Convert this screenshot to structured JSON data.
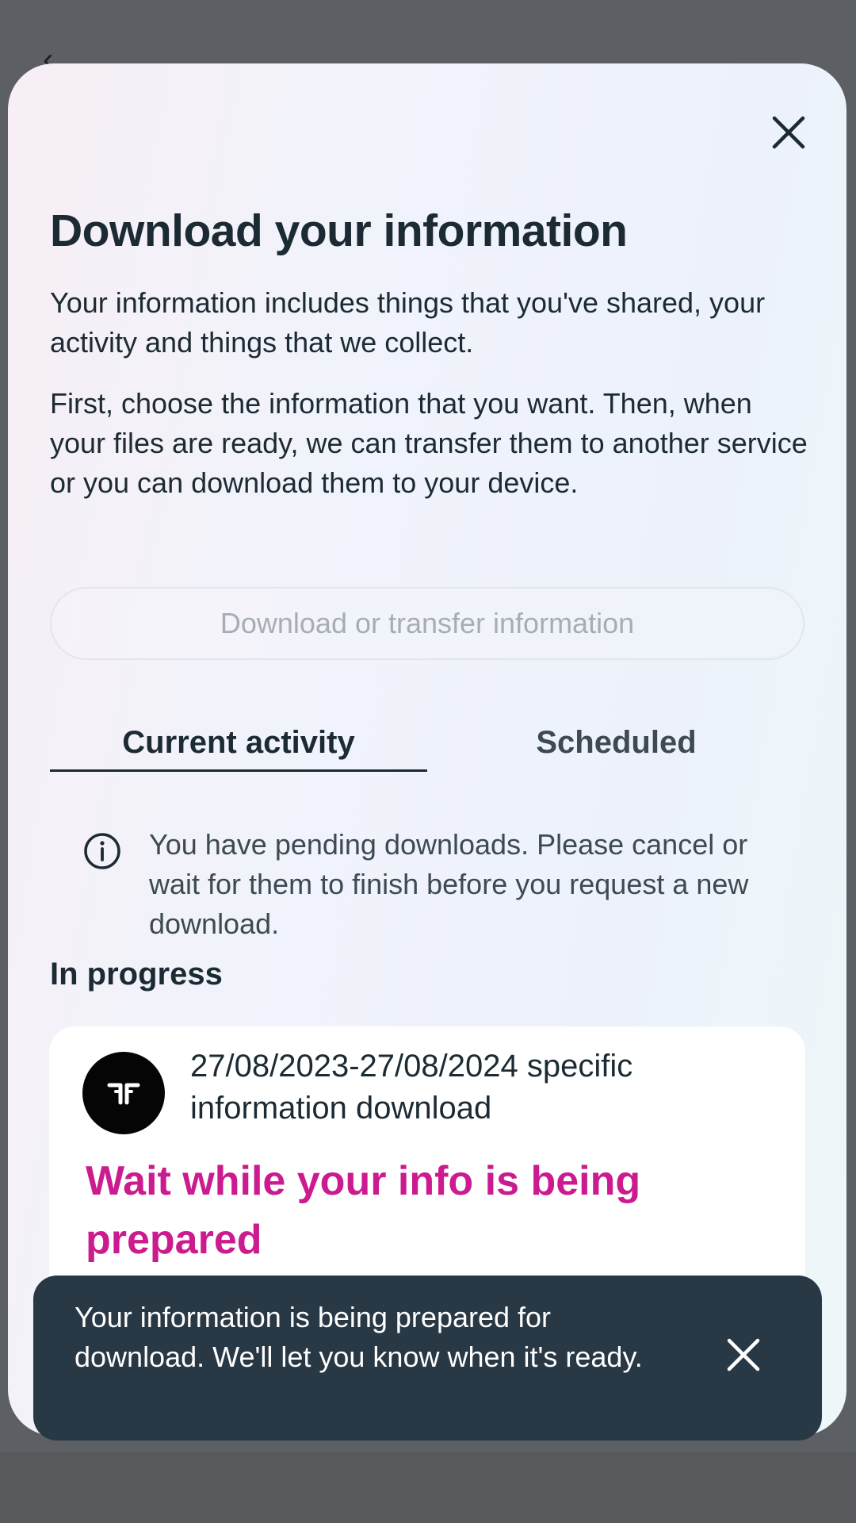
{
  "modal": {
    "title": "Download your information",
    "description_1": "Your information includes things that you've shared, your activity and things that we collect.",
    "description_2": "First, choose the information that you want. Then, when your files are ready, we can transfer them to another service or you can download them to your device.",
    "action_button_label": "Download or transfer information",
    "tabs": [
      {
        "label": "Current activity",
        "selected": true
      },
      {
        "label": "Scheduled",
        "selected": false
      }
    ],
    "notice_text": "You have pending downloads. Please cancel or wait for them to finish before you request a new download.",
    "in_progress_heading": "In progress",
    "download_card": {
      "title": "27/08/2023-27/08/2024 specific information download"
    }
  },
  "overlay_caption": "Wait while your info is being prepared",
  "toast": {
    "message": "Your information is being prepared for download. We'll let you know when it's ready."
  },
  "colors": {
    "text_primary": "#1c2b33",
    "toast_background": "#283845",
    "caption_magenta": "#cc1a8f",
    "disabled_text": "#a7adb5"
  },
  "icons": {
    "close": "close-icon",
    "info": "info-icon",
    "avatar_logo": "threads-logo-icon",
    "toast_close": "close-icon",
    "back": "back-arrow-icon"
  }
}
